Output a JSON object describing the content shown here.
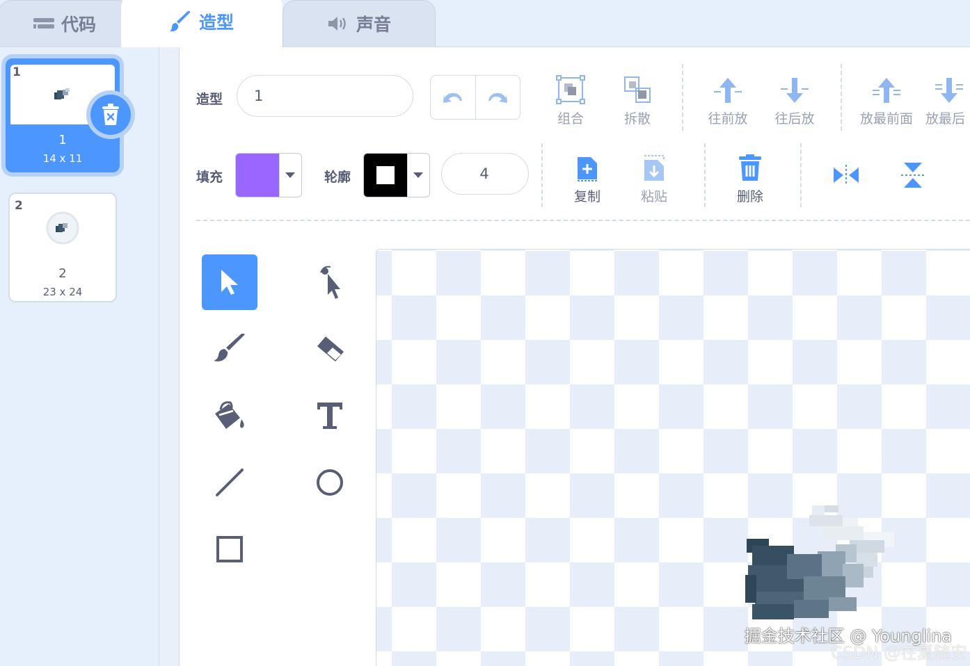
{
  "tabs": [
    {
      "label": "代码",
      "icon": "code-icon",
      "active": false
    },
    {
      "label": "造型",
      "icon": "brush-icon",
      "active": true
    },
    {
      "label": "声音",
      "icon": "speaker-icon",
      "active": false
    }
  ],
  "costumes": [
    {
      "number": "1",
      "name": "1",
      "size": "14 x 11",
      "selected": true
    },
    {
      "number": "2",
      "name": "2",
      "size": "23 x 24",
      "selected": false
    }
  ],
  "toolbar": {
    "costume_label": "造型",
    "costume_name": "1",
    "group_label": "组合",
    "ungroup_label": "拆散",
    "forward_label": "往前放",
    "backward_label": "往后放",
    "front_label": "放最前面",
    "back_label": "放最后"
  },
  "props": {
    "fill_label": "填充",
    "fill_color": "#9966ff",
    "outline_label": "轮廓",
    "outline_color": "#000000",
    "outline_width": "4",
    "copy_label": "复制",
    "paste_label": "粘贴",
    "delete_label": "删除"
  },
  "colors": {
    "accent": "#4c97ff",
    "text": "#575e75"
  },
  "watermark": {
    "line1": "掘金技术社区 @ Younglina",
    "line2": "CSDN @在夏随安"
  }
}
